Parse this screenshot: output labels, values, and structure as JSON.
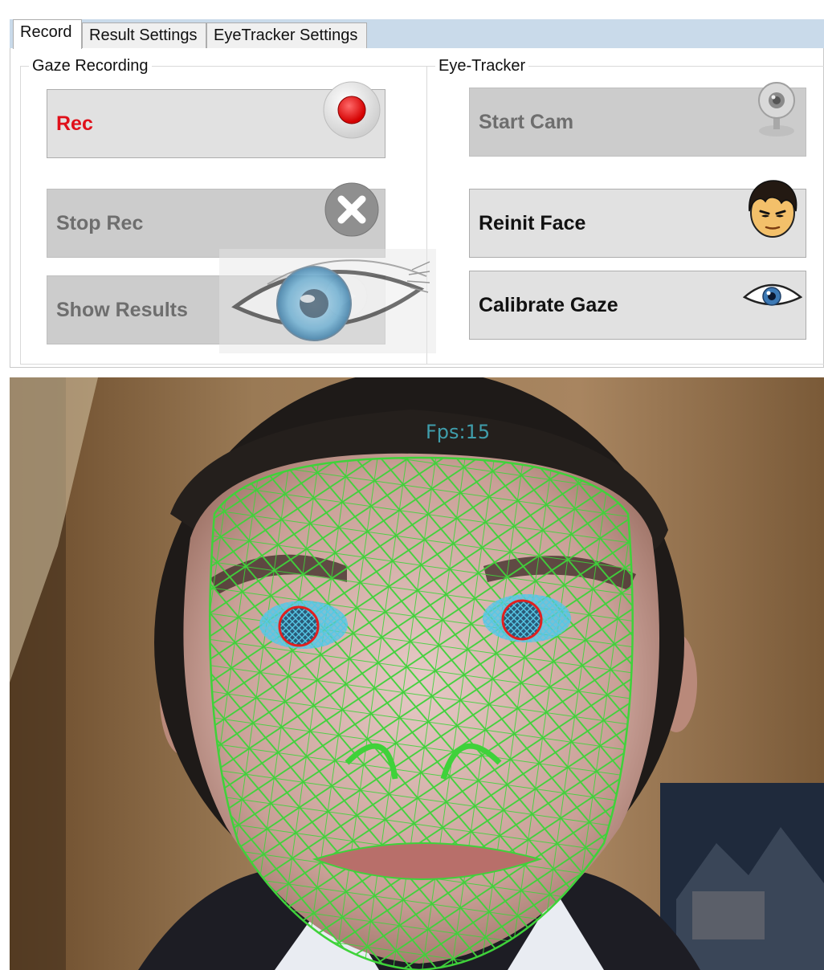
{
  "tabs": [
    {
      "label": "Record",
      "active": true
    },
    {
      "label": "Result Settings",
      "active": false
    },
    {
      "label": "EyeTracker Settings",
      "active": false
    }
  ],
  "gaze_recording": {
    "title": "Gaze Recording",
    "rec_label": "Rec",
    "stop_label": "Stop Rec",
    "show_results_label": "Show Results"
  },
  "eye_tracker": {
    "title": "Eye-Tracker",
    "start_cam_label": "Start Cam",
    "reinit_face_label": "Reinit Face",
    "calibrate_gaze_label": "Calibrate Gaze"
  },
  "camera": {
    "fps_text": "Fps:15"
  },
  "icons": {
    "rec": "record-dot-icon",
    "stop": "close-x-icon",
    "show": "play-icon",
    "start_cam": "webcam-icon",
    "reinit_face": "face-avatar-icon",
    "calibrate": "eye-icon"
  },
  "colors": {
    "rec_text": "#e0101a",
    "tab_strip": "#c9daea",
    "mesh": "#3fd23a",
    "iris": "#56c8e6",
    "pupil_ring": "#e02020"
  }
}
